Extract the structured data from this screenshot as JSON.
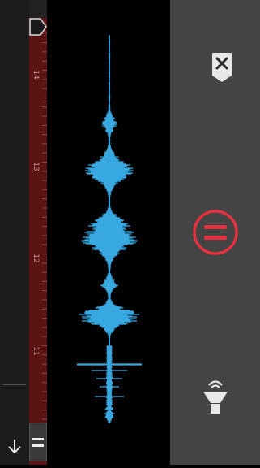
{
  "timeline": {
    "labels": [
      "14",
      "13",
      "12",
      "11"
    ]
  },
  "colors": {
    "waveform": "#39a9e1",
    "accent": "#e2323f",
    "timeline_bg": "#5a1414",
    "panel_bg": "#444444",
    "icon": "#e8e8e8"
  },
  "icons": {
    "close": "close-icon",
    "equal": "equal-icon",
    "light": "flashlight-icon",
    "down": "arrow-down-icon",
    "handle": "drag-handle-icon"
  }
}
